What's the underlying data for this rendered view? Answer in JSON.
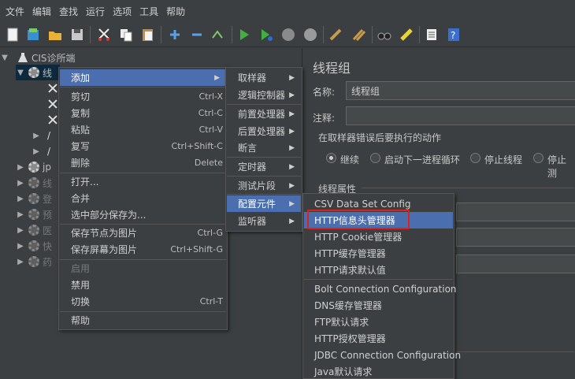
{
  "menubar": [
    "文件",
    "编辑",
    "查找",
    "运行",
    "选项",
    "工具",
    "帮助"
  ],
  "toolbar_icons": [
    "new-icon",
    "templates-icon",
    "open-icon",
    "save-icon",
    "cut-icon",
    "copy-icon",
    "paste-icon",
    "expand-icon",
    "collapse-icon",
    "toggle-icon",
    "start-icon",
    "start-no-pause-icon",
    "stop-icon",
    "shutdown-icon",
    "clear-icon",
    "clear-all-icon",
    "search-icon",
    "reset-search-icon",
    "function-helper-icon",
    "help-icon"
  ],
  "tree": {
    "root": "CIS诊所端",
    "thread_group": "线",
    "nodes": [
      "jp",
      "线",
      "登",
      "预",
      "医",
      "快",
      "药"
    ]
  },
  "right": {
    "title": "线程组",
    "name_label": "名称:",
    "name_value": "线程组",
    "comment_label": "注释:",
    "error_section": "在取样器错误后要执行的动作",
    "radios": [
      "继续",
      "启动下一进程循环",
      "停止线程",
      "停止测"
    ],
    "props_section": "线程属性"
  },
  "menu_main": {
    "items": [
      {
        "label": "添加",
        "shortcut": "",
        "submenu": true,
        "selected": true
      },
      {
        "label": "剪切",
        "shortcut": "Ctrl-X"
      },
      {
        "label": "复制",
        "shortcut": "Ctrl-C"
      },
      {
        "label": "粘贴",
        "shortcut": "Ctrl-V"
      },
      {
        "label": "复写",
        "shortcut": "Ctrl+Shift-C"
      },
      {
        "label": "删除",
        "shortcut": "Delete"
      },
      {
        "label": "打开...",
        "shortcut": ""
      },
      {
        "label": "合并",
        "shortcut": ""
      },
      {
        "label": "选中部分保存为...",
        "shortcut": ""
      },
      {
        "label": "保存节点为图片",
        "shortcut": "Ctrl-G"
      },
      {
        "label": "保存屏幕为图片",
        "shortcut": "Ctrl+Shift-G"
      },
      {
        "label": "启用",
        "shortcut": "",
        "disabled": true
      },
      {
        "label": "禁用",
        "shortcut": ""
      },
      {
        "label": "切换",
        "shortcut": "Ctrl-T"
      },
      {
        "label": "帮助",
        "shortcut": ""
      }
    ]
  },
  "menu_add": {
    "items": [
      "取样器",
      "逻辑控制器",
      "前置处理器",
      "后置处理器",
      "断言",
      "定时器",
      "测试片段",
      "配置元件",
      "监听器"
    ]
  },
  "menu_config": {
    "items": [
      "CSV Data Set Config",
      "HTTP信息头管理器",
      "HTTP Cookie管理器",
      "HTTP缓存管理器",
      "HTTP请求默认值",
      "Bolt Connection Configuration",
      "DNS缓存管理器",
      "FTP默认请求",
      "HTTP授权管理器",
      "JDBC Connection Configuration",
      "Java默认请求"
    ],
    "highlighted": "HTTP信息头管理器"
  },
  "colors": {
    "selection": "#4b6eaf",
    "highlight_box": "#e0201b",
    "background": "#3c3f41"
  }
}
